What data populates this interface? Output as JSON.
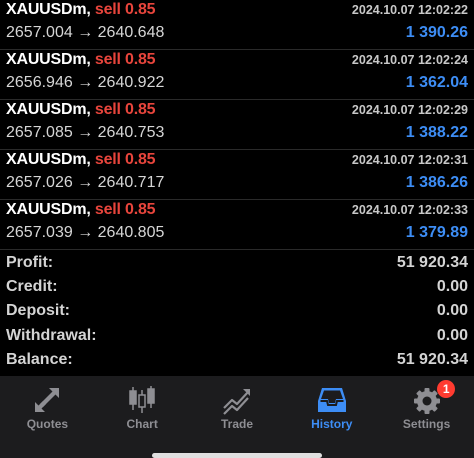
{
  "deals": [
    {
      "symbol": "XAUUSDm,",
      "type": "sell 0.85",
      "time": "2024.10.07 12:02:22",
      "open": "2657.004",
      "close": "2640.648",
      "arrow": "→",
      "profit": "1 390.26"
    },
    {
      "symbol": "XAUUSDm,",
      "type": "sell 0.85",
      "time": "2024.10.07 12:02:24",
      "open": "2656.946",
      "close": "2640.922",
      "arrow": "→",
      "profit": "1 362.04"
    },
    {
      "symbol": "XAUUSDm,",
      "type": "sell 0.85",
      "time": "2024.10.07 12:02:29",
      "open": "2657.085",
      "close": "2640.753",
      "arrow": "→",
      "profit": "1 388.22"
    },
    {
      "symbol": "XAUUSDm,",
      "type": "sell 0.85",
      "time": "2024.10.07 12:02:31",
      "open": "2657.026",
      "close": "2640.717",
      "arrow": "→",
      "profit": "1 386.26"
    },
    {
      "symbol": "XAUUSDm,",
      "type": "sell 0.85",
      "time": "2024.10.07 12:02:33",
      "open": "2657.039",
      "close": "2640.805",
      "arrow": "→",
      "profit": "1 379.89"
    }
  ],
  "summary": [
    {
      "label": "Profit:",
      "value": "51 920.34"
    },
    {
      "label": "Credit:",
      "value": "0.00"
    },
    {
      "label": "Deposit:",
      "value": "0.00"
    },
    {
      "label": "Withdrawal:",
      "value": "0.00"
    },
    {
      "label": "Balance:",
      "value": "51 920.34"
    }
  ],
  "tabs": [
    {
      "label": "Quotes",
      "icon": "quotes-arrows-icon",
      "active": false
    },
    {
      "label": "Chart",
      "icon": "candlestick-chart-icon",
      "active": false
    },
    {
      "label": "Trade",
      "icon": "trade-trend-icon",
      "active": false
    },
    {
      "label": "History",
      "icon": "history-inbox-icon",
      "active": true
    },
    {
      "label": "Settings",
      "icon": "gear-icon",
      "active": false,
      "badge": "1"
    }
  ],
  "colors": {
    "sell": "#e8453c",
    "profit": "#3d8df5",
    "tab_active": "#3d8df5",
    "tab_inactive": "#8e8e93",
    "badge": "#ff3b30"
  }
}
